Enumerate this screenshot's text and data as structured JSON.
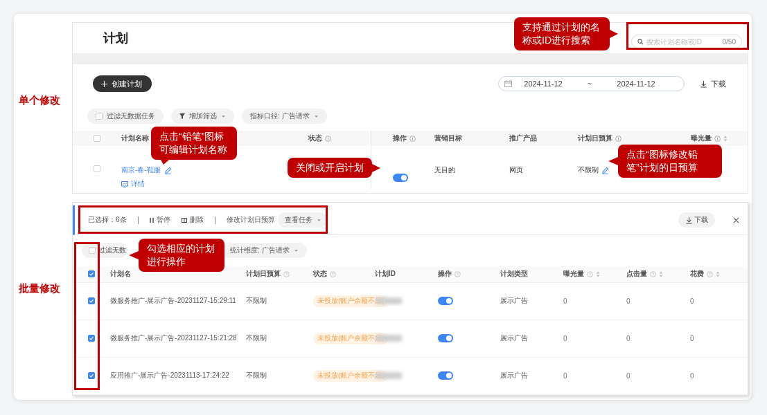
{
  "single": {
    "label": "单个修改",
    "page_title": "计划",
    "search": {
      "placeholder": "搜索计划名称或ID",
      "count": "0/50"
    },
    "create_button": "创建计划",
    "date_range": {
      "start": "2024-11-12",
      "separator": "~",
      "end": "2024-11-12"
    },
    "download": "下载",
    "filters": [
      {
        "kind": "checkbox",
        "label": "过滤无数据任务",
        "checked": false
      },
      {
        "kind": "filter",
        "label": "增加筛选"
      },
      {
        "kind": "select",
        "label": "指标口径: 广告请求"
      }
    ],
    "table": {
      "select_all_checked": false,
      "columns": [
        {
          "label": "计划名称",
          "kind": "plain"
        },
        {
          "label": "状态",
          "kind": "info"
        },
        {
          "label": "操作",
          "kind": "info"
        },
        {
          "label": "营销目标",
          "kind": "plain"
        },
        {
          "label": "推广产品",
          "kind": "plain"
        },
        {
          "label": "计划日预算",
          "kind": "info"
        },
        {
          "label": "曝光量",
          "kind": "sortable"
        }
      ],
      "rows": [
        {
          "checked": false,
          "name": "南京-春-鞋服",
          "detail": "详情",
          "on": true,
          "goal": "无目的",
          "product": "网页",
          "budget": "不限制"
        }
      ]
    }
  },
  "batch": {
    "label": "批量修改",
    "selection": "已选择：6条",
    "actions": [
      {
        "kind": "pause",
        "label": "暂停"
      },
      {
        "kind": "delete",
        "label": "删除"
      },
      {
        "kind": "plain",
        "label": "修改计划日预算"
      },
      {
        "kind": "dropdown",
        "label": "查看任务"
      }
    ],
    "download": "下载",
    "filters": [
      {
        "kind": "checkbox",
        "label": "过滤无数",
        "checked": false
      },
      {
        "kind": "select",
        "label": "统计维度: 广告请求"
      }
    ],
    "table": {
      "select_all_checked": true,
      "columns": [
        {
          "label": "计划名",
          "kind": "plain"
        },
        {
          "label": "计划日预算",
          "kind": "info"
        },
        {
          "label": "状态",
          "kind": "info"
        },
        {
          "label": "计划ID",
          "kind": "plain"
        },
        {
          "label": "操作",
          "kind": "info"
        },
        {
          "label": "计划类型",
          "kind": "plain"
        },
        {
          "label": "曝光量",
          "kind": "sortable"
        },
        {
          "label": "点击量",
          "kind": "sortable"
        },
        {
          "label": "花费",
          "kind": "sortable"
        }
      ],
      "rows": [
        {
          "checked": true,
          "name": "微服务推广-展示广告-20231127-15:29:11",
          "budget": "不限制",
          "status": "未投放(账户余额不足)",
          "on": true,
          "type": "展示广告",
          "impressions": "0",
          "clicks": "0",
          "cost": "0"
        },
        {
          "checked": true,
          "name": "微服务推广-展示广告-20231127-15:21:28",
          "budget": "不限制",
          "status": "未投放(账户余额不足)",
          "on": true,
          "type": "展示广告",
          "impressions": "0",
          "clicks": "0",
          "cost": "0"
        },
        {
          "checked": true,
          "name": "应用推广-展示广告-20231113-17:24:22",
          "budget": "不限制",
          "status": "未投放(账户余额不足)",
          "on": true,
          "type": "展示广告",
          "impressions": "0",
          "clicks": "0",
          "cost": "0"
        }
      ]
    }
  },
  "callouts": [
    "支持通过计划的名称或ID进行搜索",
    "点击“铅笔”图标可编辑计划名称",
    "关闭或开启计划",
    "点击“图标修改铅笔”计划的日预算",
    "勾选相应的计划进行操作"
  ]
}
